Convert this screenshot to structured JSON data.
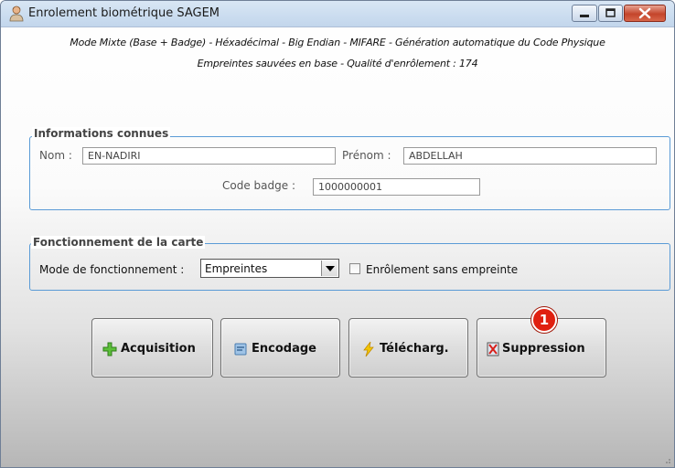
{
  "window": {
    "title": "Enrolement biométrique SAGEM",
    "icon": "user-icon"
  },
  "info": {
    "line1": "Mode Mixte (Base + Badge) - Héxadécimal - Big Endian - MIFARE - Génération automatique du Code Physique",
    "line2": "Empreintes sauvées en base - Qualité d'enrôlement : 174"
  },
  "known_info": {
    "legend": "Informations connues",
    "nom_label": "Nom :",
    "nom_value": "EN-NADIRI",
    "prenom_label": "Prénom :",
    "prenom_value": "ABDELLAH",
    "badge_label": "Code badge :",
    "badge_value": "1000000001"
  },
  "card_mode": {
    "legend": "Fonctionnement de la carte",
    "mode_label": "Mode de fonctionnement :",
    "mode_value": "Empreintes",
    "checkbox_label": "Enrôlement sans empreinte",
    "checkbox_checked": false
  },
  "buttons": {
    "acquisition": "Acquisition",
    "encodage": "Encodage",
    "telecharg": "Télécharg.",
    "suppression": "Suppression"
  },
  "badge_number": "1",
  "colors": {
    "group_border": "#5a9bd6",
    "badge": "#e02010",
    "close_button": "#c4452b"
  }
}
